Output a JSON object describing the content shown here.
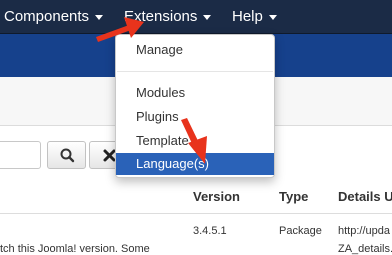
{
  "navbar": {
    "components_label": "Components",
    "extensions_label": "Extensions",
    "help_label": "Help"
  },
  "dropdown": {
    "manage": "Manage",
    "modules": "Modules",
    "plugins": "Plugins",
    "templates": "Template",
    "languages": "Language(s)"
  },
  "table": {
    "headers": {
      "version": "Version",
      "type": "Type",
      "details": "Details U"
    },
    "row": {
      "text_left": "tch this Joomla! version. Some",
      "version": "3.4.5.1",
      "type": "Package",
      "details_line1": "http://upda",
      "details_line2": "ZA_details."
    }
  },
  "colors": {
    "navbar": "#1b2b46",
    "header_band": "#16418c",
    "highlight": "#2a62b8",
    "annotation_arrow": "#e8331c"
  },
  "icons": {
    "search": "search-icon",
    "clear": "close-icon",
    "caret": "caret-down-icon",
    "annotation": "red-arrow-annotation"
  }
}
